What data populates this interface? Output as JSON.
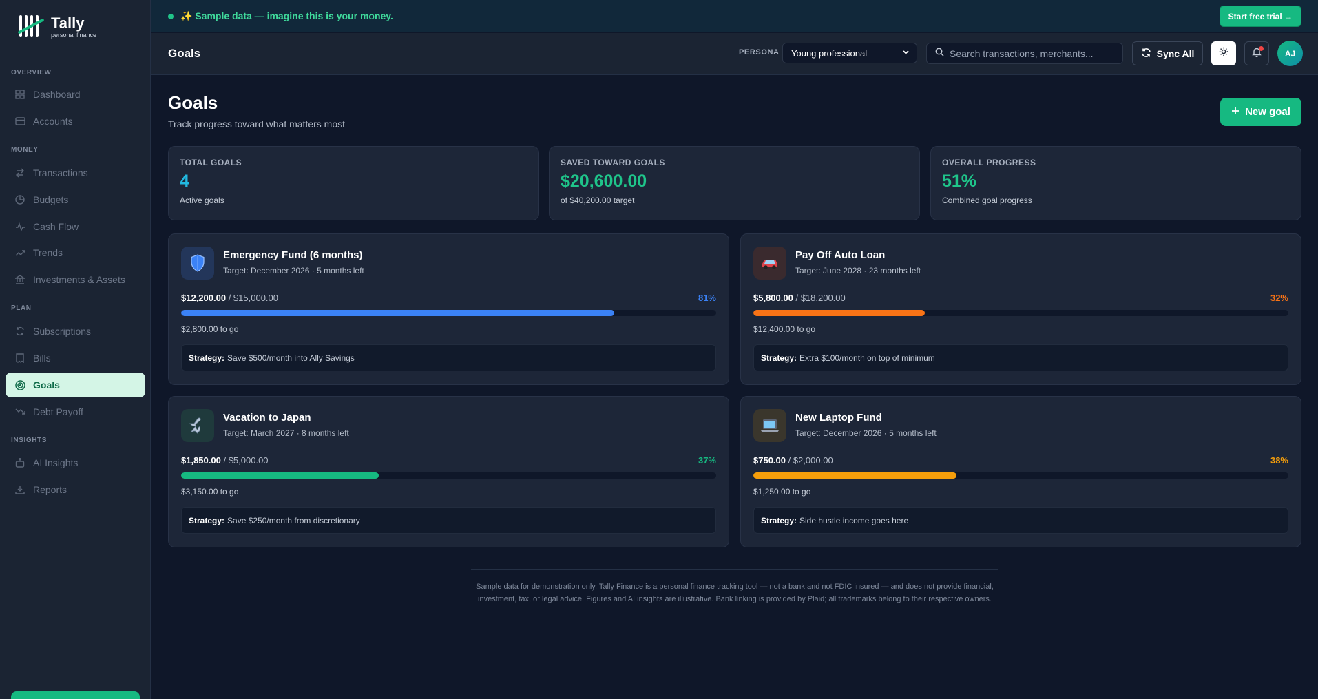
{
  "brand": {
    "name": "Tally",
    "tagline": "personal finance"
  },
  "sidebar": {
    "sections": [
      {
        "label": "OVERVIEW",
        "items": [
          {
            "label": "Dashboard",
            "icon": "grid-icon"
          },
          {
            "label": "Accounts",
            "icon": "card-icon"
          }
        ]
      },
      {
        "label": "MONEY",
        "items": [
          {
            "label": "Transactions",
            "icon": "arrows-icon"
          },
          {
            "label": "Budgets",
            "icon": "pie-icon"
          },
          {
            "label": "Cash Flow",
            "icon": "pulse-icon"
          },
          {
            "label": "Trends",
            "icon": "trend-up-icon"
          },
          {
            "label": "Investments & Assets",
            "icon": "bank-icon"
          }
        ]
      },
      {
        "label": "PLAN",
        "items": [
          {
            "label": "Subscriptions",
            "icon": "refresh-icon"
          },
          {
            "label": "Bills",
            "icon": "receipt-icon"
          },
          {
            "label": "Goals",
            "icon": "target-icon",
            "active": true
          },
          {
            "label": "Debt Payoff",
            "icon": "trend-down-icon"
          }
        ]
      },
      {
        "label": "INSIGHTS",
        "items": [
          {
            "label": "AI Insights",
            "icon": "robot-icon"
          },
          {
            "label": "Reports",
            "icon": "download-icon"
          }
        ]
      }
    ]
  },
  "banner": {
    "text": "✨ Sample data — imagine this is your money.",
    "cta": "Start free trial →"
  },
  "header": {
    "title": "Goals",
    "persona_label": "PERSONA",
    "persona_value": "Young professional",
    "search_placeholder": "Search transactions, merchants...",
    "sync_label": "Sync All",
    "avatar_initials": "AJ"
  },
  "page": {
    "title": "Goals",
    "subtitle": "Track progress toward what matters most",
    "new_goal": "New goal"
  },
  "stats": [
    {
      "label": "TOTAL GOALS",
      "value": "4",
      "sub": "Active goals",
      "color": "#22b8e0"
    },
    {
      "label": "SAVED TOWARD GOALS",
      "value": "$20,600.00",
      "sub": "of $40,200.00 target",
      "color": "#1fc48a"
    },
    {
      "label": "OVERALL PROGRESS",
      "value": "51%",
      "sub": "Combined goal progress",
      "color": "#1fc48a"
    }
  ],
  "goals": [
    {
      "name": "Emergency Fund (6 months)",
      "icon": "shield-icon",
      "emoji": "🛡️",
      "icon_bg": "#23365a",
      "target": "Target: December 2026 · 5 months left",
      "saved": "$12,200.00",
      "total": "/ $15,000.00",
      "pct_label": "81%",
      "progress": 0.81,
      "color": "#3b82f6",
      "to_go": "$2,800.00 to go",
      "strategy_label": "Strategy:",
      "strategy": "Save $500/month into Ally Savings"
    },
    {
      "name": "Pay Off Auto Loan",
      "icon": "car-icon",
      "emoji": "🚗",
      "icon_bg": "#3a2a2e",
      "target": "Target: June 2028 · 23 months left",
      "saved": "$5,800.00",
      "total": "/ $18,200.00",
      "pct_label": "32%",
      "progress": 0.32,
      "color": "#f97316",
      "to_go": "$12,400.00 to go",
      "strategy_label": "Strategy:",
      "strategy": "Extra $100/month on top of minimum"
    },
    {
      "name": "Vacation to Japan",
      "icon": "airplane-icon",
      "emoji": "✈️",
      "icon_bg": "#1f3a3c",
      "target": "Target: March 2027 · 8 months left",
      "saved": "$1,850.00",
      "total": "/ $5,000.00",
      "pct_label": "37%",
      "progress": 0.37,
      "color": "#16b981",
      "to_go": "$3,150.00 to go",
      "strategy_label": "Strategy:",
      "strategy": "Save $250/month from discretionary"
    },
    {
      "name": "New Laptop Fund",
      "icon": "laptop-icon",
      "emoji": "💻",
      "icon_bg": "#3a362c",
      "target": "Target: December 2026 · 5 months left",
      "saved": "$750.00",
      "total": "/ $2,000.00",
      "pct_label": "38%",
      "progress": 0.38,
      "color": "#f59e0b",
      "to_go": "$1,250.00 to go",
      "strategy_label": "Strategy:",
      "strategy": "Side hustle income goes here"
    }
  ],
  "footer": {
    "text": "Sample data for demonstration only. Tally Finance is a personal finance tracking tool — not a bank and not FDIC insured — and does not provide financial, investment, tax, or legal advice. Figures and AI insights are illustrative. Bank linking is provided by Plaid; all trademarks belong to their respective owners."
  }
}
